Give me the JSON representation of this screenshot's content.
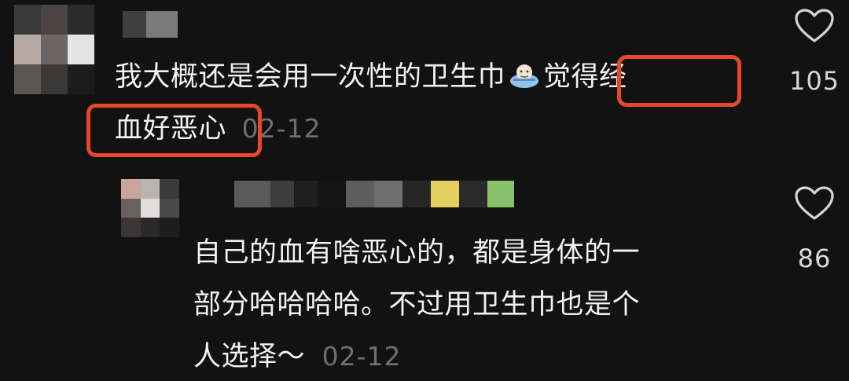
{
  "comments": [
    {
      "text": "我大概还是会用一次性的卫生巾",
      "text_cont": "觉得经",
      "text_line2": "血好恶心",
      "date": "02-12",
      "likes": "105"
    },
    {
      "line1": "自己的血有啥恶心的，都是身体的一",
      "line2": "部分哈哈哈哈。不过用卫生巾也是个",
      "line3": "人选择～",
      "date": "02-12",
      "likes": "86"
    }
  ],
  "colors": {
    "background": "#121212",
    "highlight": "#e8472a",
    "text": "#f2f2f2",
    "date": "#6f6f6f"
  },
  "icons": {
    "like": "heart-outline-icon",
    "emoji": "sticker-emoji-icon"
  }
}
